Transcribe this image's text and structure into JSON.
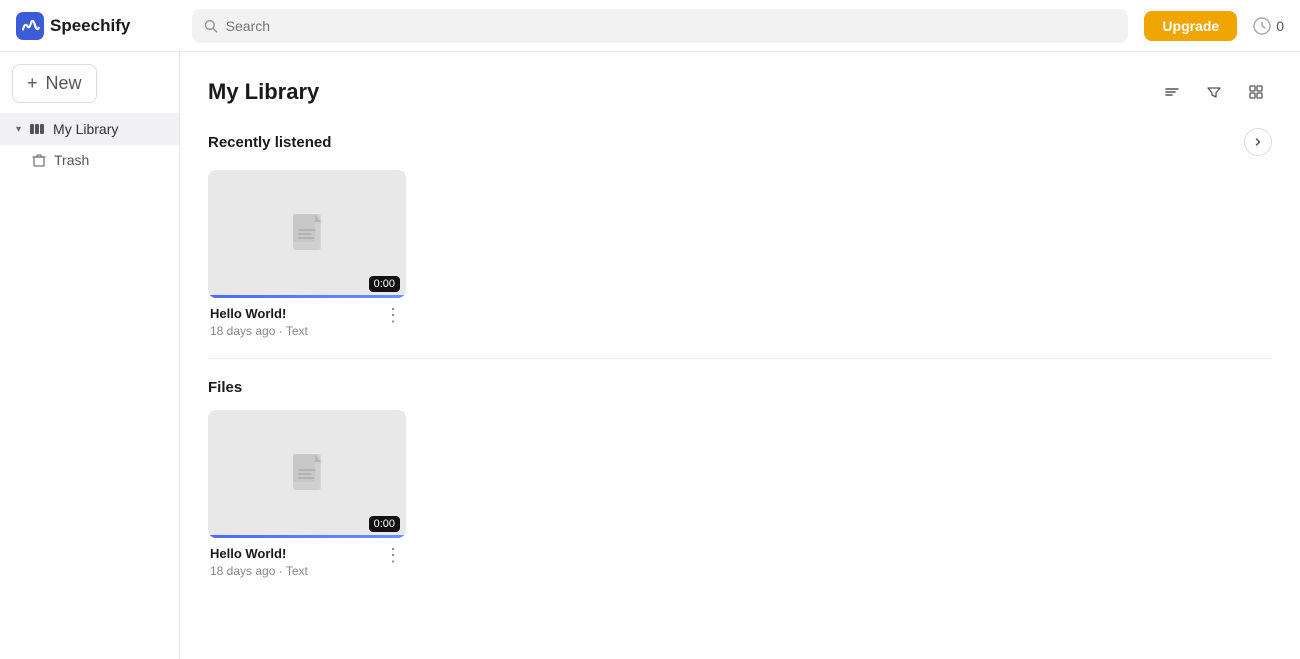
{
  "topbar": {
    "logo_text": "Speechify",
    "search_placeholder": "Search",
    "upgrade_label": "Upgrade",
    "credits_count": "0"
  },
  "sidebar": {
    "new_label": "New",
    "items": [
      {
        "id": "my-library",
        "label": "My Library",
        "active": true
      },
      {
        "id": "trash",
        "label": "Trash",
        "active": false
      }
    ]
  },
  "content": {
    "title": "My Library",
    "sections": [
      {
        "id": "recently-listened",
        "label": "Recently listened",
        "cards": [
          {
            "id": "card-1",
            "title": "Hello World!",
            "meta": "18 days ago · Text",
            "time": "0:00"
          }
        ]
      },
      {
        "id": "files",
        "label": "Files",
        "cards": [
          {
            "id": "card-2",
            "title": "Hello World!",
            "meta": "18 days ago · Text",
            "time": "0:00"
          }
        ]
      }
    ]
  },
  "icons": {
    "sort": "⇅",
    "filter": "⊟",
    "grid": "⊞",
    "chevron_right": "›",
    "chevron_down": "∨",
    "doc": "🗎",
    "trash": "🗑",
    "library": "📚",
    "more": "⋮",
    "plus": "+"
  }
}
